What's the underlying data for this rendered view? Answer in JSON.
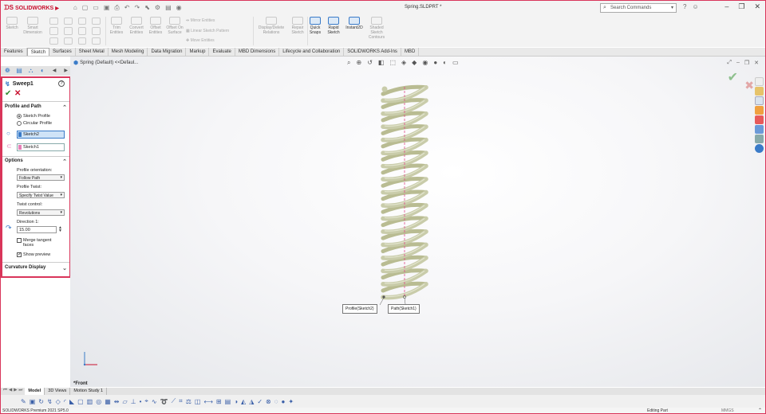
{
  "app": {
    "brand": "SOLIDWORKS",
    "document_title": "Spring.SLDPRT *",
    "search_placeholder": "Search Commands",
    "win_controls": {
      "minimize": "–",
      "restore": "❐",
      "close": "✕"
    }
  },
  "ribbon": {
    "items": [
      {
        "label": "Sketch",
        "active": false
      },
      {
        "label": "Smart Dimension",
        "active": false
      },
      {
        "label": "Trim Entities",
        "active": false
      },
      {
        "label": "Convert Entities",
        "active": false
      },
      {
        "label": "Offset Entities",
        "active": false
      },
      {
        "label": "Offset On Surface",
        "active": false
      },
      {
        "label": "Display/Delete Relations",
        "active": false
      },
      {
        "label": "Repair Sketch",
        "active": false
      },
      {
        "label": "Quick Snaps",
        "active": true
      },
      {
        "label": "Rapid Sketch",
        "active": true
      },
      {
        "label": "Instant2D",
        "active": true
      },
      {
        "label": "Shaded Sketch Contours",
        "active": false
      }
    ],
    "mirror_entities": "Mirror Entities",
    "linear_pattern": "Linear Sketch Pattern",
    "move_entities": "Move Entities"
  },
  "command_tabs": [
    "Features",
    "Sketch",
    "Surfaces",
    "Sheet Metal",
    "Mesh Modeling",
    "Data Migration",
    "Markup",
    "Evaluate",
    "MBD Dimensions",
    "Lifecycle and Collaboration",
    "SOLIDWORKS Add-Ins",
    "MBD"
  ],
  "active_tab": "Sketch",
  "viewport": {
    "breadcrumb": "Spring (Default) <<Defaul...",
    "view_label": "*Front",
    "callout_profile": "Profile(Sketch2)",
    "callout_path": "Path(Sketch1)"
  },
  "property_manager": {
    "title": "Sweep1",
    "profile_and_path": {
      "header": "Profile and Path",
      "option_sketch_profile": "Sketch Profile",
      "option_circular_profile": "Circular Profile",
      "profile_value": "Sketch2",
      "path_value": "Sketch1"
    },
    "options": {
      "header": "Options",
      "profile_orientation_label": "Profile orientation:",
      "profile_orientation_value": "Follow Path",
      "profile_twist_label": "Profile Twist:",
      "profile_twist_value": "Specify Twist Value",
      "twist_control_label": "Twist control:",
      "twist_control_value": "Revolutions",
      "direction_label": "Direction 1:",
      "direction_value": "15.00",
      "merge_tangent": "Merge tangent faces",
      "show_preview": "Show preview"
    },
    "curvature_header": "Curvature Display"
  },
  "bottom_tabs": [
    "Model",
    "3D Views",
    "Motion Study 1"
  ],
  "status": {
    "left": "SOLIDWORKS Premium 2021 SP5.0",
    "mid": "Editing Part",
    "units": "MMGS"
  }
}
